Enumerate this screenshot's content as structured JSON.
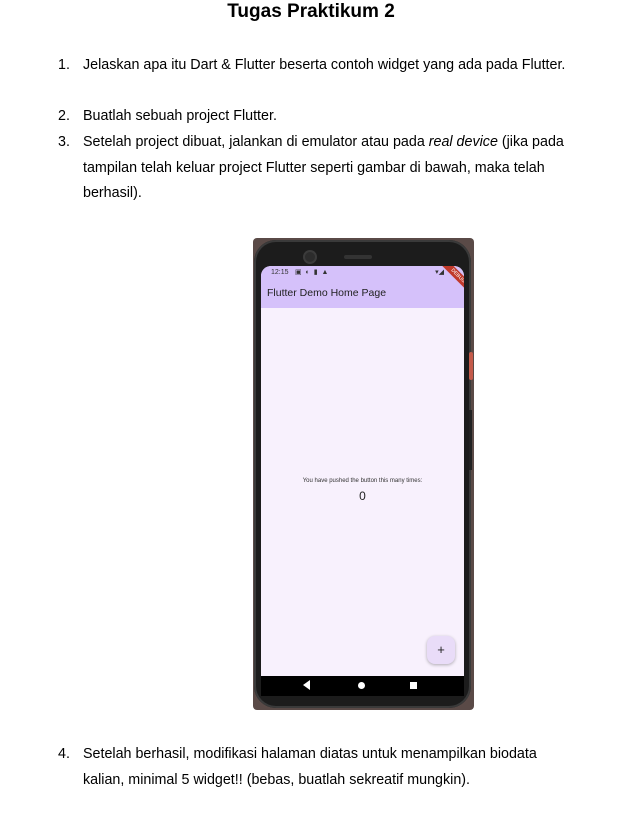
{
  "title": "Tugas Praktikum 2",
  "items": [
    {
      "num": "1.",
      "text": "Jelaskan apa itu Dart & Flutter beserta contoh widget yang ada pada Flutter."
    },
    {
      "num": "2.",
      "text": "Buatlah sebuah project Flutter."
    },
    {
      "num": "3.",
      "text_before": "Setelah project dibuat, jalankan di emulator atau pada ",
      "text_italic": "real device",
      "text_after": " (jika pada tampilan telah keluar project Flutter seperti gambar di bawah, maka telah berhasil)."
    },
    {
      "num": "4.",
      "text": "Setelah berhasil, modifikasi halaman diatas untuk menampilkan biodata kalian, minimal 5 widget!! (bebas, buatlah sekreatif mungkin)."
    }
  ],
  "phone": {
    "status_time": "12:15",
    "debug_banner": "DEBUG",
    "app_title": "Flutter Demo Home Page",
    "counter_text": "You have pushed the button this many times:",
    "counter_value": "0",
    "fab_label": "+"
  }
}
